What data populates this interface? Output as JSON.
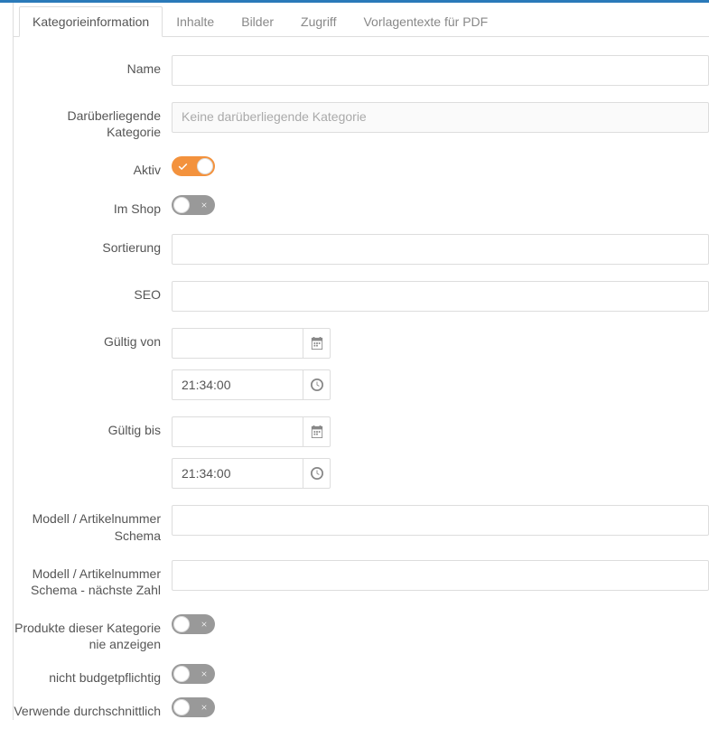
{
  "tabs": [
    {
      "label": "Kategorieinformation",
      "active": true
    },
    {
      "label": "Inhalte",
      "active": false
    },
    {
      "label": "Bilder",
      "active": false
    },
    {
      "label": "Zugriff",
      "active": false
    },
    {
      "label": "Vorlagentexte für PDF",
      "active": false
    }
  ],
  "fields": {
    "name": {
      "label": "Name",
      "value": ""
    },
    "parent_category": {
      "label": "Darüberliegende Kategorie",
      "placeholder": "Keine darüberliegende Kategorie"
    },
    "active": {
      "label": "Aktiv",
      "on": true
    },
    "in_shop": {
      "label": "Im Shop",
      "on": false
    },
    "sort": {
      "label": "Sortierung",
      "value": ""
    },
    "seo": {
      "label": "SEO",
      "value": ""
    },
    "valid_from": {
      "label": "Gültig von",
      "date": "",
      "time": "21:34:00"
    },
    "valid_to": {
      "label": "Gültig bis",
      "date": "",
      "time": "21:34:00"
    },
    "model_schema": {
      "label": "Modell / Artikelnummer Schema",
      "value": ""
    },
    "model_schema_next": {
      "label": "Modell / Artikelnummer Schema - nächste Zahl",
      "value": ""
    },
    "hide_products": {
      "label": "Produkte dieser Kategorie nie anzeigen",
      "on": false
    },
    "not_budget": {
      "label": "nicht budgetpflichtig",
      "on": false
    },
    "use_avg": {
      "label": "Verwende durchschnittlich",
      "on": false
    }
  }
}
